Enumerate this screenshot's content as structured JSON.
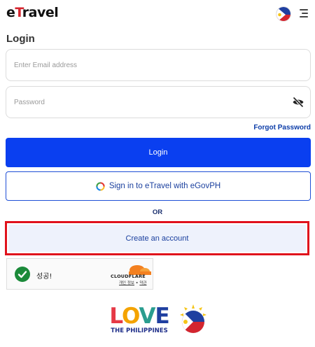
{
  "header": {
    "logo_prefix": "e",
    "logo_accent": "T",
    "logo_rest": "ravel",
    "icons": {
      "flag": "philippines-flag-icon",
      "menu": "hamburger-menu-icon"
    }
  },
  "page": {
    "title": "Login"
  },
  "form": {
    "email_placeholder": "Enter Email address",
    "email_value": "",
    "password_placeholder": "Password",
    "password_value": "",
    "forgot_label": "Forgot Password",
    "login_label": "Login",
    "egov_label": "Sign in to eTravel with eGovPH",
    "or_label": "OR",
    "create_label": "Create an account"
  },
  "captcha": {
    "status_text": "성공!",
    "brand": "CLOUDFLARE",
    "link_privacy": "개인 정보",
    "separator": " • ",
    "link_terms": "약관"
  },
  "footer": {
    "love_text": "LOVE",
    "tagline": "THE PHILIPPINES"
  },
  "colors": {
    "primary": "#0a3ff0",
    "link": "#0b3ca8",
    "highlight": "#e0121c",
    "success": "#1b8a3a",
    "cloudflare": "#f38020"
  }
}
